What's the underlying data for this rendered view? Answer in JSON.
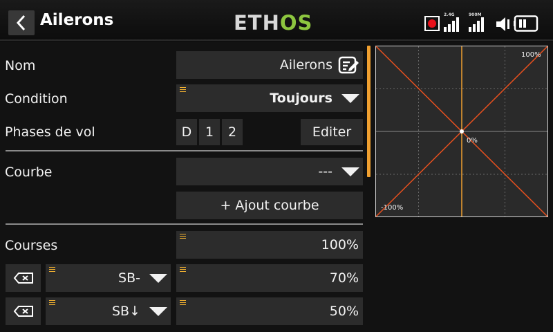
{
  "header": {
    "title": "Ailerons",
    "logo_text": "ETHOS",
    "signal_1_label": "2.4G",
    "signal_2_label": "900M"
  },
  "form": {
    "name": {
      "label": "Nom",
      "value": "Ailerons"
    },
    "condition": {
      "label": "Condition",
      "value": "Toujours"
    },
    "flight_phases": {
      "label": "Phases de vol",
      "phases": [
        "D",
        "1",
        "2"
      ],
      "edit_label": "Editer"
    },
    "curve": {
      "label": "Courbe",
      "value": "---",
      "add_label": "+ Ajout courbe"
    },
    "rates": {
      "label": "Courses",
      "value": "100%",
      "rows": [
        {
          "switch": "SB-",
          "value": "70%"
        },
        {
          "switch": "SB↓",
          "value": "50%"
        }
      ]
    }
  },
  "graph": {
    "top_right_label": "100%",
    "center_label": "0%",
    "bottom_left_label": "-100%"
  },
  "colors": {
    "accent": "#f0a030",
    "curve": "#e8501e",
    "logo_green": "#8dc63f",
    "record": "#e8101a"
  },
  "icons": [
    "back-arrow-icon",
    "edit-icon",
    "record-icon",
    "signal-icon",
    "speaker-icon",
    "battery-icon",
    "delete-icon",
    "dropdown-icon"
  ]
}
